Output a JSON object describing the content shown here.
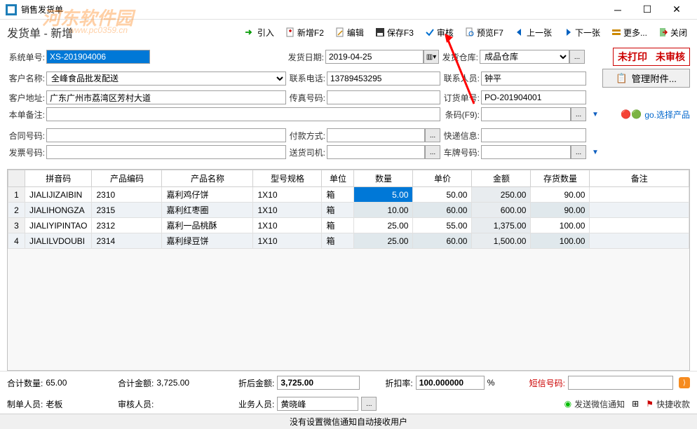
{
  "window": {
    "title": "销售发货单"
  },
  "watermark": {
    "text": "河东软件园",
    "sub": "www.pc0359.cn"
  },
  "page_title": "发货单 - 新增",
  "toolbar": {
    "import": "引入",
    "new": "新增F2",
    "edit": "编辑",
    "save": "保存F3",
    "audit": "审核",
    "preview": "预览F7",
    "prev": "上一张",
    "next": "下一张",
    "more": "更多...",
    "close": "关闭"
  },
  "status": {
    "unprinted": "未打印",
    "unaudited": "未审核"
  },
  "form": {
    "sys_no_label": "系统单号:",
    "sys_no": "XS-201904006",
    "ship_date_label": "发货日期:",
    "ship_date": "2019-04-25",
    "ship_wh_label": "发货仓库:",
    "ship_wh": "成品仓库",
    "cust_name_label": "客户名称:",
    "cust_name": "全峰食品批发配送",
    "phone_label": "联系电话:",
    "phone": "13789453295",
    "contact_label": "联系人员:",
    "contact": "钟平",
    "cust_addr_label": "客户地址:",
    "cust_addr": "广东广州市荔湾区芳村大道",
    "fax_label": "传真号码:",
    "fax": "",
    "order_no_label": "订货单号:",
    "order_no": "PO-201904001",
    "remark_label": "本单备注:",
    "remark": "",
    "barcode_label": "条码(F9):",
    "barcode": "",
    "contract_label": "合同号码:",
    "contract": "",
    "pay_method_label": "付款方式:",
    "pay_method": "",
    "express_label": "快递信息:",
    "express": "",
    "invoice_label": "发票号码:",
    "invoice": "",
    "driver_label": "送货司机:",
    "driver": "",
    "plate_label": "车牌号码:",
    "plate": ""
  },
  "side": {
    "manage_attach": "管理附件...",
    "select_product": "go.选择产品"
  },
  "grid": {
    "headers": [
      "拼音码",
      "产品编码",
      "产品名称",
      "型号规格",
      "单位",
      "数量",
      "单价",
      "金额",
      "存货数量",
      "备注"
    ],
    "rows": [
      {
        "n": "1",
        "py": "JIALIJIZAIBIN",
        "code": "2310",
        "name": "嘉利鸡仔饼",
        "spec": "1X10",
        "unit": "箱",
        "qty": "5.00",
        "price": "50.00",
        "amt": "250.00",
        "stock": "90.00",
        "remark": ""
      },
      {
        "n": "2",
        "py": "JIALIHONGZA",
        "code": "2315",
        "name": "嘉利红枣圈",
        "spec": "1X10",
        "unit": "箱",
        "qty": "10.00",
        "price": "60.00",
        "amt": "600.00",
        "stock": "90.00",
        "remark": ""
      },
      {
        "n": "3",
        "py": "JIALIYIPINTAO",
        "code": "2312",
        "name": "嘉利一品桃酥",
        "spec": "1X10",
        "unit": "箱",
        "qty": "25.00",
        "price": "55.00",
        "amt": "1,375.00",
        "stock": "100.00",
        "remark": ""
      },
      {
        "n": "4",
        "py": "JIALILVDOUBI",
        "code": "2314",
        "name": "嘉利绿豆饼",
        "spec": "1X10",
        "unit": "箱",
        "qty": "25.00",
        "price": "60.00",
        "amt": "1,500.00",
        "stock": "100.00",
        "remark": ""
      }
    ]
  },
  "summary": {
    "total_qty_label": "合计数量:",
    "total_qty": "65.00",
    "total_amt_label": "合计金额:",
    "total_amt": "3,725.00",
    "discount_amt_label": "折后金额:",
    "discount_amt": "3,725.00",
    "discount_rate_label": "折扣率:",
    "discount_rate": "100.000000",
    "discount_unit": "%",
    "sms_label": "短信号码:",
    "sms": ""
  },
  "bottom": {
    "creator_label": "制单人员:",
    "creator": "老板",
    "auditor_label": "审核人员:",
    "auditor": "",
    "biz_label": "业务人员:",
    "biz": "黄晓峰",
    "wechat": "发送微信通知",
    "quick_collect": "快捷收款"
  },
  "statusbar": {
    "text": "没有设置微信通知自动接收用户"
  }
}
